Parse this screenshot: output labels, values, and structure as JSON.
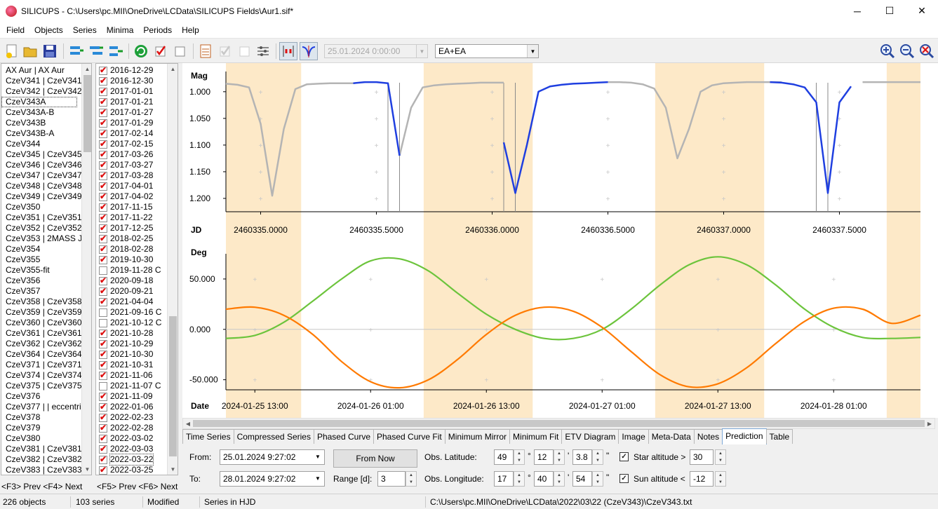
{
  "window": {
    "title": "SILICUPS - C:\\Users\\pc.MII\\OneDrive\\LCData\\SILICUPS Fields\\Aur1.sif*"
  },
  "menu": [
    "Field",
    "Objects",
    "Series",
    "Minima",
    "Periods",
    "Help"
  ],
  "toolbar": {
    "date_combo": "25.01.2024   0:00:00",
    "type_combo": "EA+EA"
  },
  "objects": [
    "AX Aur | AX Aur",
    "CzeV341 | CzeV341",
    "CzeV342 | CzeV342",
    "CzeV343A",
    "CzeV343A-B",
    "CzeV343B",
    "CzeV343B-A",
    "CzeV344",
    "CzeV345 | CzeV345",
    "CzeV346 | CzeV346 |",
    "CzeV347 | CzeV347",
    "CzeV348 | CzeV348",
    "CzeV349 | CzeV349",
    "CzeV350",
    "CzeV351 | CzeV351",
    "CzeV352 | CzeV352",
    "CzeV353 | 2MASS J0!",
    "CzeV354",
    "CzeV355",
    "CzeV355-fit",
    "CzeV356",
    "CzeV357",
    "CzeV358 | CzeV358",
    "CzeV359 | CzeV359",
    "CzeV360 | CzeV360",
    "CzeV361 | CzeV361",
    "CzeV362 | CzeV362",
    "CzeV364 | CzeV364 |",
    "CzeV371 | CzeV371",
    "CzeV374 | CzeV374",
    "CzeV375 | CzeV375",
    "CzeV376",
    "CzeV377 | | eccentric",
    "CzeV378",
    "CzeV379",
    "CzeV380",
    "CzeV381 | CzeV381",
    "CzeV382 | CzeV382",
    "CzeV383 | CzeV383"
  ],
  "series": [
    {
      "label": "2016-12-29",
      "checked": true
    },
    {
      "label": "2016-12-30",
      "checked": true
    },
    {
      "label": "2017-01-01",
      "checked": true
    },
    {
      "label": "2017-01-21",
      "checked": true
    },
    {
      "label": "2017-01-27",
      "checked": true
    },
    {
      "label": "2017-01-29",
      "checked": true
    },
    {
      "label": "2017-02-14",
      "checked": true
    },
    {
      "label": "2017-02-15",
      "checked": true
    },
    {
      "label": "2017-03-26",
      "checked": true
    },
    {
      "label": "2017-03-27",
      "checked": true
    },
    {
      "label": "2017-03-28",
      "checked": true
    },
    {
      "label": "2017-04-01",
      "checked": true
    },
    {
      "label": "2017-04-02",
      "checked": true
    },
    {
      "label": "2017-11-15",
      "checked": true
    },
    {
      "label": "2017-11-22",
      "checked": true
    },
    {
      "label": "2017-12-25",
      "checked": true
    },
    {
      "label": "2018-02-25",
      "checked": true
    },
    {
      "label": "2018-02-28",
      "checked": true
    },
    {
      "label": "2019-10-30",
      "checked": true
    },
    {
      "label": "2019-11-28 C",
      "checked": false
    },
    {
      "label": "2020-09-18",
      "checked": true
    },
    {
      "label": "2020-09-21",
      "checked": true
    },
    {
      "label": "2021-04-04",
      "checked": true
    },
    {
      "label": "2021-09-16 C",
      "checked": false
    },
    {
      "label": "2021-10-12 C",
      "checked": false
    },
    {
      "label": "2021-10-28",
      "checked": true
    },
    {
      "label": "2021-10-29",
      "checked": true
    },
    {
      "label": "2021-10-30",
      "checked": true
    },
    {
      "label": "2021-10-31",
      "checked": true
    },
    {
      "label": "2021-11-06",
      "checked": true
    },
    {
      "label": "2021-11-07 C",
      "checked": false
    },
    {
      "label": "2021-11-09",
      "checked": true
    },
    {
      "label": "2022-01-06",
      "checked": true
    },
    {
      "label": "2022-02-23",
      "checked": true
    },
    {
      "label": "2022-02-28",
      "checked": true
    },
    {
      "label": "2022-03-02",
      "checked": true
    },
    {
      "label": "2022-03-03",
      "checked": true
    },
    {
      "label": "2022-03-22",
      "checked": true
    },
    {
      "label": "2022-03-25",
      "checked": true
    }
  ],
  "nav_hints": {
    "objects": "<F3> Prev  <F4> Next",
    "series": "<F5> Prev  <F6> Next"
  },
  "chart_data": [
    {
      "type": "line",
      "title": "",
      "ylabel": "Mag",
      "xlabel": "JD",
      "x_ticks": [
        "2460335.0000",
        "2460335.5000",
        "2460336.0000",
        "2460336.5000",
        "2460337.0000",
        "2460337.5000"
      ],
      "y_ticks": [
        "1.000",
        "1.050",
        "1.100",
        "1.150",
        "1.200"
      ],
      "ylim": [
        0.97,
        1.225
      ],
      "y_inverted": true,
      "x": [
        2460334.85,
        2460334.9,
        2460334.95,
        2460335.0,
        2460335.05,
        2460335.1,
        2460335.15,
        2460335.2,
        2460335.25,
        2460335.3,
        2460335.35,
        2460335.4,
        2460335.45,
        2460335.5,
        2460335.55,
        2460335.6,
        2460335.65,
        2460335.7,
        2460335.75,
        2460335.8,
        2460335.85,
        2460335.9,
        2460335.95,
        2460336.0,
        2460336.05,
        2460336.1,
        2460336.15,
        2460336.2,
        2460336.25,
        2460336.3,
        2460336.35,
        2460336.4,
        2460336.45,
        2460336.5,
        2460336.55,
        2460336.6,
        2460336.65,
        2460336.7,
        2460336.75,
        2460336.8,
        2460336.85,
        2460336.9,
        2460336.95,
        2460337.0,
        2460337.05,
        2460337.1,
        2460337.15,
        2460337.2,
        2460337.25,
        2460337.3,
        2460337.35,
        2460337.4,
        2460337.45,
        2460337.5,
        2460337.55,
        2460337.6,
        2460337.65,
        2460337.7,
        2460337.75,
        2460337.8,
        2460337.85
      ],
      "series": [
        {
          "color": "#b4b4b4",
          "values": [
            0.985,
            0.987,
            0.992,
            1.06,
            1.195,
            1.07,
            0.995,
            0.986,
            0.985,
            0.984,
            0.984,
            0.984,
            null,
            null,
            null,
            1.12,
            1.03,
            0.992,
            0.988,
            0.986,
            0.985,
            0.984,
            0.983,
            0.983,
            0.983,
            null,
            null,
            null,
            null,
            null,
            null,
            null,
            null,
            0.982,
            0.982,
            0.983,
            0.986,
            0.994,
            1.03,
            1.125,
            1.07,
            1.0,
            0.988,
            0.984,
            0.983,
            0.982,
            0.982,
            0.982,
            0.982,
            null,
            null,
            null,
            null,
            null,
            null,
            0.982,
            0.982,
            0.982,
            0.982,
            0.982,
            0.982
          ]
        },
        {
          "color": "#1f3fe0",
          "values": [
            null,
            null,
            null,
            null,
            null,
            null,
            null,
            null,
            null,
            null,
            null,
            0.984,
            0.982,
            0.982,
            0.984,
            1.12,
            null,
            null,
            null,
            null,
            null,
            null,
            null,
            null,
            1.095,
            1.19,
            1.1,
            1.0,
            0.99,
            0.987,
            0.985,
            0.984,
            0.983,
            0.982,
            null,
            null,
            null,
            null,
            null,
            null,
            null,
            null,
            null,
            null,
            null,
            null,
            null,
            0.982,
            0.983,
            0.986,
            0.992,
            1.02,
            1.19,
            1.02,
            0.99,
            null,
            null,
            null,
            null,
            null,
            null
          ]
        }
      ]
    },
    {
      "type": "line",
      "title": "",
      "ylabel": "Deg",
      "xlabel": "Date",
      "x_ticks": [
        "2024-01-25 13:00",
        "2024-01-26 01:00",
        "2024-01-26 13:00",
        "2024-01-27 01:00",
        "2024-01-27 13:00",
        "2024-01-28 01:00"
      ],
      "y_ticks": [
        "50.000",
        "0.000",
        "-50.000"
      ],
      "ylim": [
        -60,
        75
      ],
      "x_hours": [
        0,
        3,
        6,
        9,
        12,
        15,
        18,
        21,
        24,
        27,
        30,
        33,
        36,
        39,
        42,
        45,
        48,
        51,
        54,
        57,
        60,
        63,
        66,
        69,
        72
      ],
      "series": [
        {
          "color": "#6cc43c",
          "values": [
            -9,
            -6,
            7,
            28,
            50,
            68,
            70,
            58,
            36,
            15,
            0,
            -9,
            -9,
            0,
            20,
            44,
            64,
            72,
            64,
            44,
            20,
            2,
            -8,
            -9,
            -8
          ]
        },
        {
          "color": "#ff7a00",
          "values": [
            20,
            22,
            14,
            -5,
            -32,
            -52,
            -58,
            -50,
            -30,
            -5,
            14,
            22,
            18,
            2,
            -22,
            -45,
            -57,
            -54,
            -38,
            -14,
            8,
            21,
            20,
            6,
            14
          ]
        }
      ],
      "night_bands_hours": [
        [
          0,
          7.8
        ],
        [
          20.5,
          31.8
        ],
        [
          44.5,
          55.8
        ],
        [
          68.5,
          72
        ]
      ]
    }
  ],
  "tabs": [
    "Time Series",
    "Compressed Series",
    "Phased Curve",
    "Phased Curve Fit",
    "Minimum Mirror",
    "Minimum Fit",
    "ETV Diagram",
    "Image",
    "Meta-Data",
    "Notes",
    "Prediction",
    "Table"
  ],
  "active_tab": "Prediction",
  "prediction": {
    "from_label": "From:",
    "from_value": "25.01.2024   9:27:02",
    "to_label": "To:",
    "to_value": "28.01.2024   9:27:02",
    "from_now": "From Now",
    "range_label": "Range [d]:",
    "range_value": "3",
    "lat_label": "Obs. Latitude:",
    "lat": [
      "49",
      "12",
      "3.8"
    ],
    "lon_label": "Obs. Longitude:",
    "lon": [
      "17",
      "40",
      "54"
    ],
    "deg_sym": "°",
    "min_sym": "'",
    "sec_sym": "\"",
    "star_alt_label": "Star altitude >",
    "star_alt": "30",
    "sun_alt_label": "Sun altitude <",
    "sun_alt": "-12"
  },
  "status": {
    "objects": "226 objects",
    "series": "103 series",
    "modified": "Modified",
    "hjd": "Series in HJD",
    "path": "C:\\Users\\pc.MII\\OneDrive\\LCData\\2022\\03\\22 (CzeV343)\\CzeV343.txt"
  },
  "colors": {
    "night_band": "#fde9c8",
    "accent_blue": "#1f3fe0",
    "grey_curve": "#b4b4b4",
    "green_curve": "#6cc43c",
    "orange_curve": "#ff7a00"
  }
}
